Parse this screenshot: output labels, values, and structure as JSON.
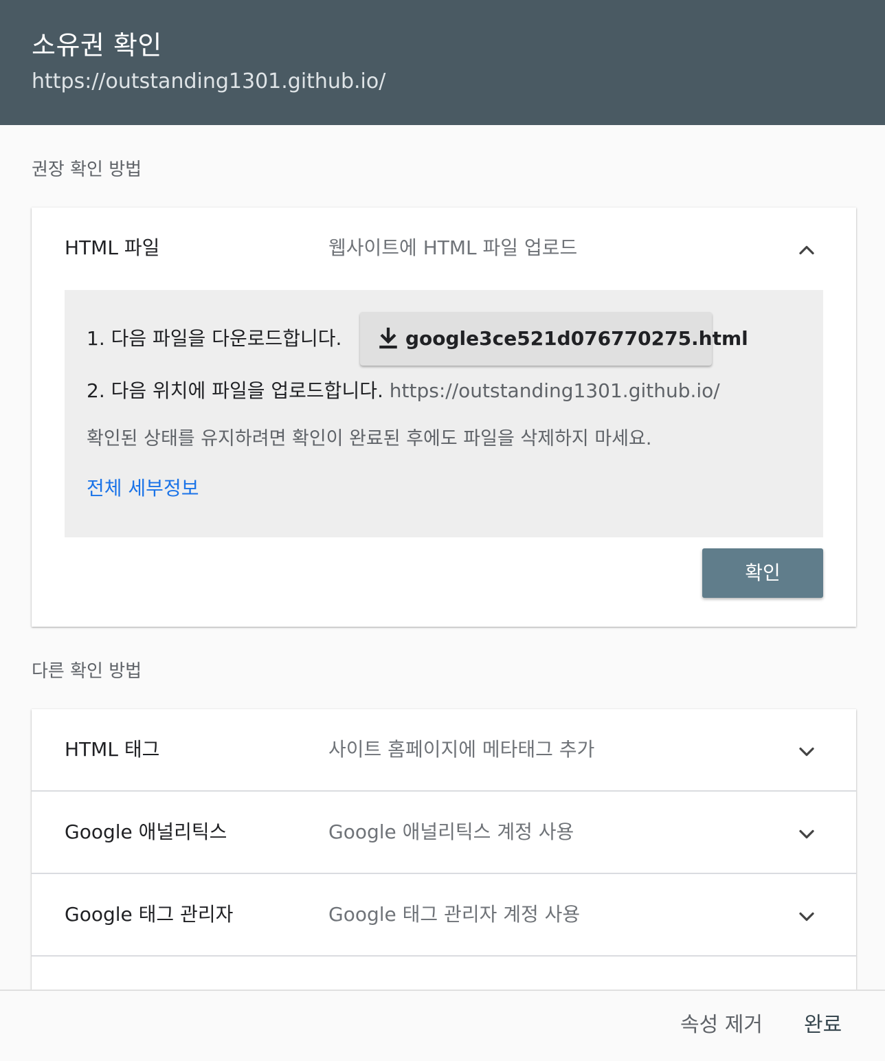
{
  "header": {
    "title": "소유권 확인",
    "url": "https://outstanding1301.github.io/"
  },
  "recommended": {
    "section_label": "권장 확인 방법",
    "method": {
      "name": "HTML 파일",
      "description": "웹사이트에 HTML 파일 업로드",
      "expanded": true,
      "chevron_icon": "chevron-up-icon"
    },
    "panel": {
      "step1": "1. 다음 파일을 다운로드합니다.",
      "download_icon": "download-icon",
      "download_file": "google3ce521d076770275.html",
      "step2": "2. 다음 위치에 파일을 업로드합니다.",
      "step2_url": "https://outstanding1301.github.io/",
      "note": "확인된 상태를 유지하려면 확인이 완료된 후에도 파일을 삭제하지 마세요.",
      "details_link": "전체 세부정보"
    },
    "confirm_button": "확인"
  },
  "other": {
    "section_label": "다른 확인 방법",
    "methods": [
      {
        "name": "HTML 태그",
        "description": "사이트 홈페이지에 메타태그 추가",
        "chevron_icon": "chevron-down-icon"
      },
      {
        "name": "Google 애널리틱스",
        "description": "Google 애널리틱스 계정 사용",
        "chevron_icon": "chevron-down-icon"
      },
      {
        "name": "Google 태그 관리자",
        "description": "Google 태그 관리자 계정 사용",
        "chevron_icon": "chevron-down-icon"
      }
    ]
  },
  "footer": {
    "remove_label": "속성 제거",
    "done_label": "완료"
  },
  "colors": {
    "header_bg": "#4a5a63",
    "confirm_bg": "#607d8b",
    "link": "#1a73e8",
    "panel_bg": "#eeeeee"
  }
}
